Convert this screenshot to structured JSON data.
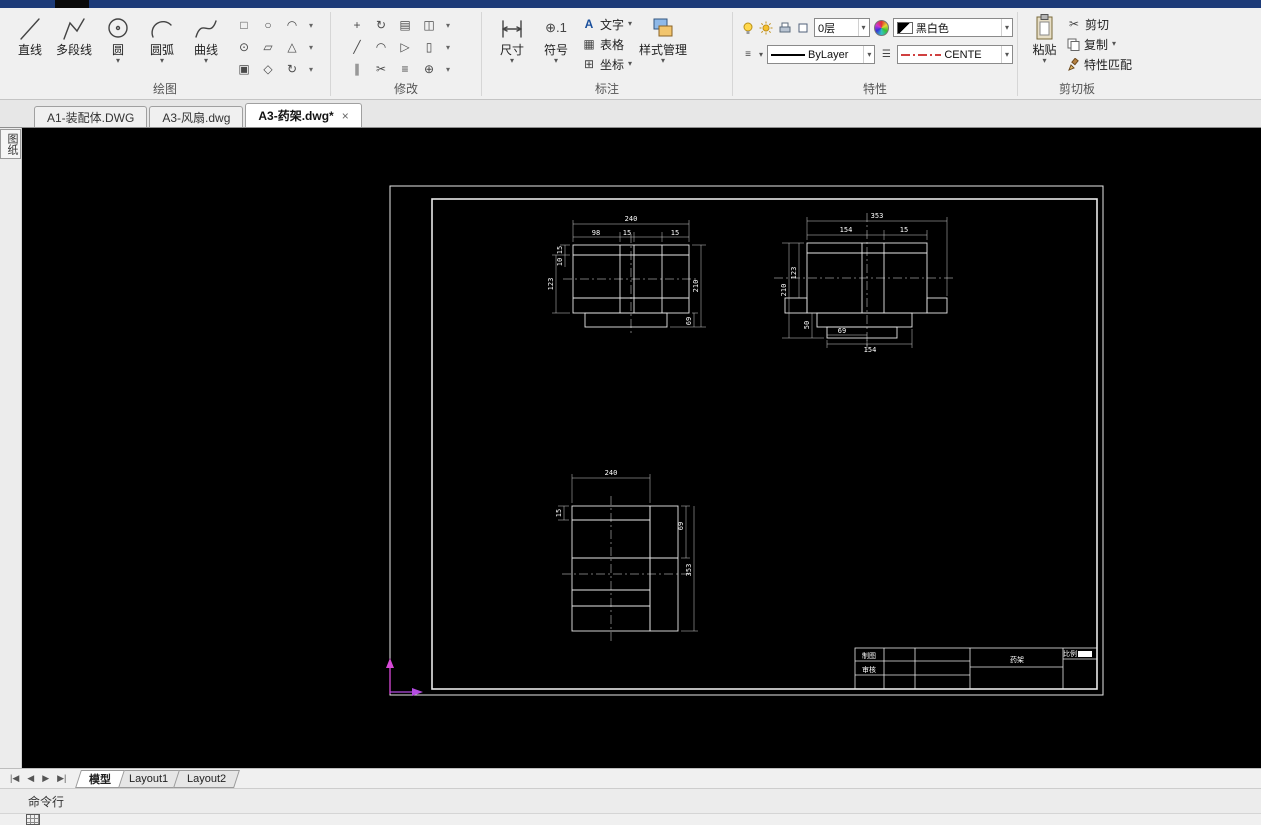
{
  "icons": {
    "dropdown": "▾",
    "close": "×",
    "scissors": "✂",
    "hamburger": "≡",
    "list": "☰",
    "text_glyph": "A",
    "table_glyph": "▦",
    "coord_glyph": "⊞",
    "nav_first": "|◀",
    "nav_prev": "◀",
    "nav_next": "▶",
    "nav_last": "▶|"
  },
  "ribbon": {
    "panel_labels": {
      "draw": "绘图",
      "modify": "修改",
      "annotate": "标注",
      "properties": "特性",
      "clipboard": "剪切板"
    },
    "draw": {
      "line": "直线",
      "polyline": "多段线",
      "circle": "圆",
      "arc": "圆弧",
      "spline": "曲线",
      "grid": [
        "□",
        "○",
        "◠",
        "⊙",
        "▱",
        "△",
        "▣",
        "◇",
        "↻"
      ]
    },
    "modify": {
      "grid": [
        "+",
        "↻",
        "▤",
        "◫",
        "╱",
        "◠",
        "▷",
        "▯",
        "∥",
        "✂",
        "≡",
        "⊕"
      ]
    },
    "annotate": {
      "dimension": "尺寸",
      "symbol": "符号",
      "symbol_glyph": "⊕.1",
      "text": "文字",
      "table": "表格",
      "coordinate": "坐标",
      "style_manager": "样式管理"
    },
    "properties": {
      "layer": "0层",
      "color": "黑白色",
      "lineweight": "ByLayer",
      "linetype": "CENTE"
    },
    "clipboard": {
      "paste": "粘贴",
      "cut": "剪切",
      "copy": "复制",
      "match": "特性匹配"
    }
  },
  "doc_tabs": {
    "tab1": "A1-装配体.DWG",
    "tab2": "A3-风扇.dwg",
    "tab3": "A3-药架.dwg*"
  },
  "left_palette": "图纸",
  "layout": {
    "model": "模型",
    "layout1": "Layout1",
    "layout2": "Layout2"
  },
  "command": {
    "prompt": "命令行"
  },
  "drawing": {
    "title_block": {
      "maker": "制图",
      "checker": "审核",
      "part": "药架",
      "scale": "比例"
    },
    "front": {
      "w": "240",
      "a": "98",
      "b": "15",
      "c": "15",
      "lt": "15",
      "lh": "123",
      "ls": "10",
      "rh": "210",
      "rs": "69"
    },
    "side": {
      "w": "353",
      "a": "154",
      "b": "15",
      "l1": "123",
      "l2": "210",
      "l3": "50",
      "b1": "69",
      "b2": "154"
    },
    "top": {
      "w": "240",
      "lt": "15",
      "r1": "69",
      "rh": "353"
    }
  }
}
